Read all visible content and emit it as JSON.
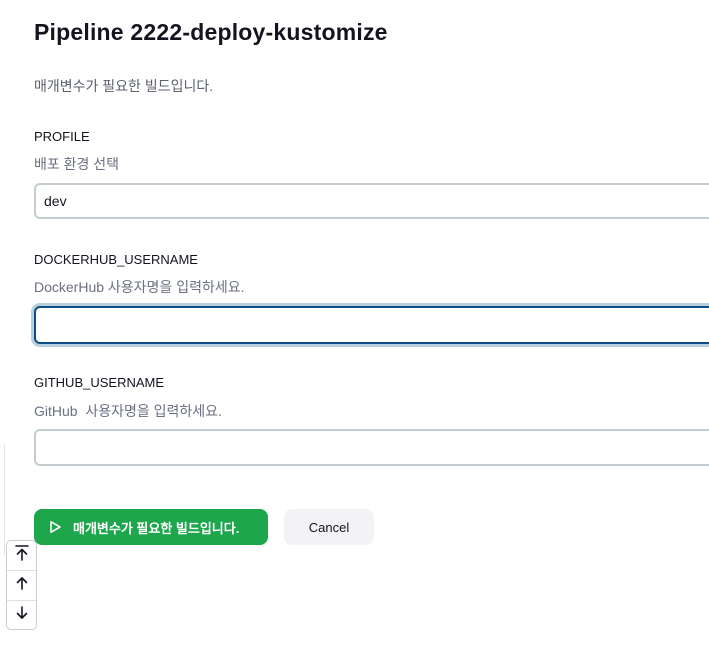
{
  "page": {
    "title": "Pipeline 2222-deploy-kustomize",
    "subtitle": "매개변수가 필요한 빌드입니다."
  },
  "params": [
    {
      "name": "PROFILE",
      "description": "배포 환경 선택",
      "value": "dev",
      "focused": false
    },
    {
      "name": "DOCKERHUB_USERNAME",
      "description": "DockerHub 사용자명을 입력하세요.",
      "value": "",
      "focused": true
    },
    {
      "name": "GITHUB_USERNAME",
      "description": "GitHub  사용자명을 입력하세요.",
      "value": "",
      "focused": false
    }
  ],
  "actions": {
    "build_label": "매개변수가 필요한 빌드입니다.",
    "build_icon": "play-icon",
    "cancel_label": "Cancel"
  },
  "scroll_controls": {
    "icons": [
      "scroll-to-top-icon",
      "arrow-up-icon",
      "arrow-down-icon"
    ]
  },
  "colors": {
    "primary_green": "#1ea64d",
    "focus_border": "#0f4c81",
    "focus_ring": "#b6d0de",
    "field_border": "#c3ccd1"
  }
}
